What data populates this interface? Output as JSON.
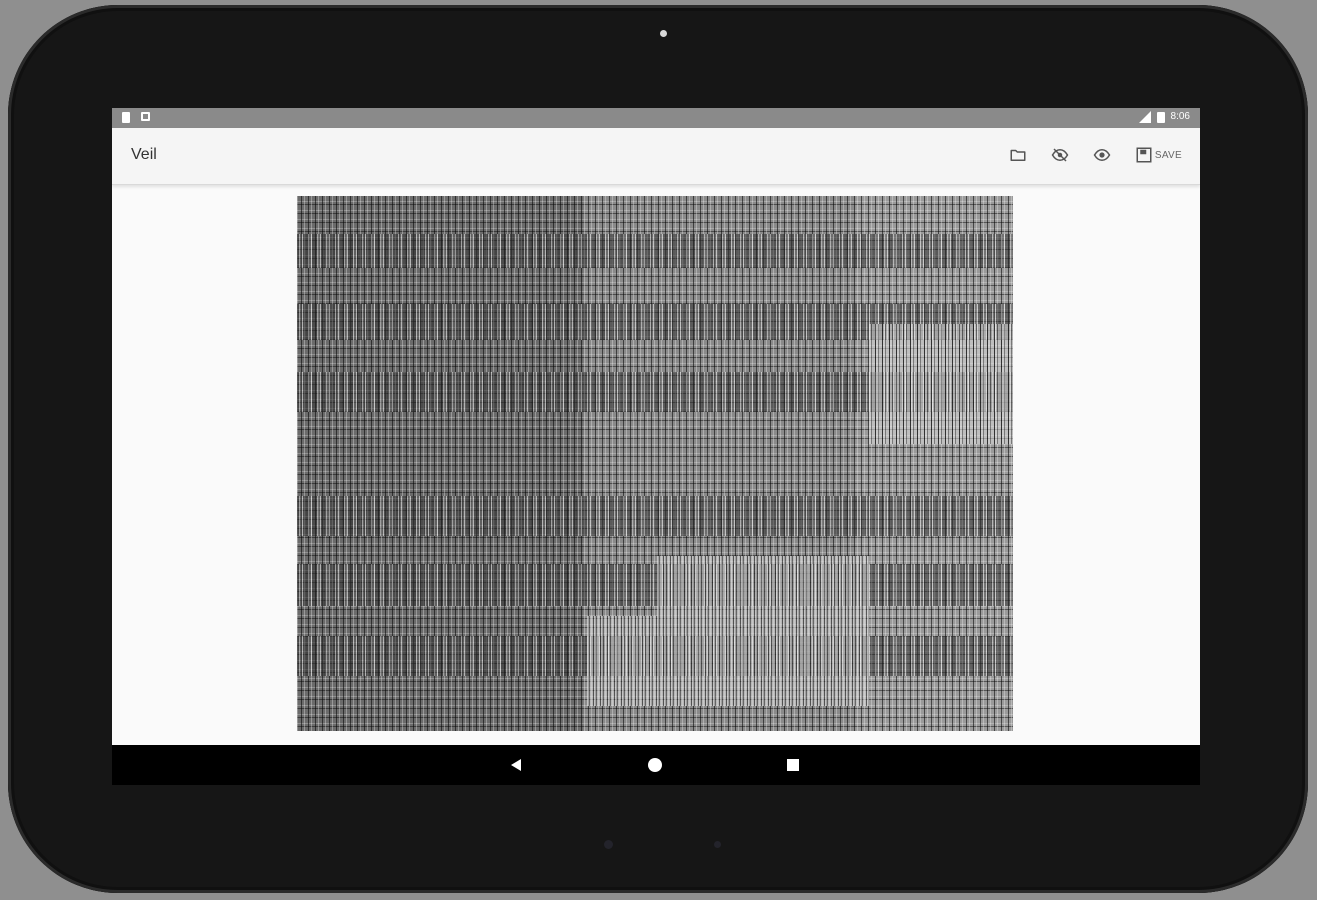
{
  "app": {
    "title": "Veil"
  },
  "status_bar": {
    "time": "8:06"
  },
  "toolbar": {
    "actions": [
      {
        "icon": "folder-icon",
        "label": ""
      },
      {
        "icon": "eye-off-icon",
        "label": ""
      },
      {
        "icon": "eye-icon",
        "label": ""
      },
      {
        "icon": "save-icon",
        "label": "SAVE"
      }
    ]
  },
  "content": {
    "image_description_icon": "veiled-image"
  },
  "nav": {
    "buttons": [
      "back-icon",
      "home-icon",
      "recents-icon"
    ]
  },
  "colors": {
    "status_bar": "#8a8a8a",
    "app_bar": "#f5f5f5",
    "nav_bar": "#000000",
    "bezel": "#161616"
  }
}
